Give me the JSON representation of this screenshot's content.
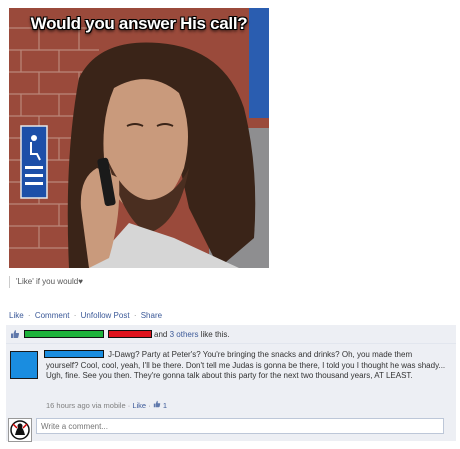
{
  "photo": {
    "caption": "Would you answer His call?"
  },
  "post": {
    "text": "'Like' if you would♥"
  },
  "actions": {
    "like": "Like",
    "comment": "Comment",
    "unfollow": "Unfollow Post",
    "share": "Share",
    "separator": "·"
  },
  "likes": {
    "and": "and",
    "others": "3 others",
    "suffix": "like this."
  },
  "comment": {
    "text_line1": "J-Dawg? Party at Peter's? You're bringing the snacks and drinks? Oh, you made them",
    "text_rest": "yourself? Cool, cool, yeah, I'll be there. Don't tell me Judas is gonna be there, I told you I thought he was shady... Ugh, fine. See you then. They're gonna talk about this party for the next two thousand years, AT LEAST.",
    "timestamp": "16 hours ago via mobile",
    "like": "Like",
    "like_count": "1",
    "separator": "·"
  },
  "write_comment": {
    "placeholder": "Write a comment..."
  },
  "colors": {
    "link": "#3b5998",
    "ufi_bg": "#edeff4",
    "redact_green": "#1db33b",
    "redact_red": "#e0141e",
    "redact_blue": "#1a8de0"
  }
}
